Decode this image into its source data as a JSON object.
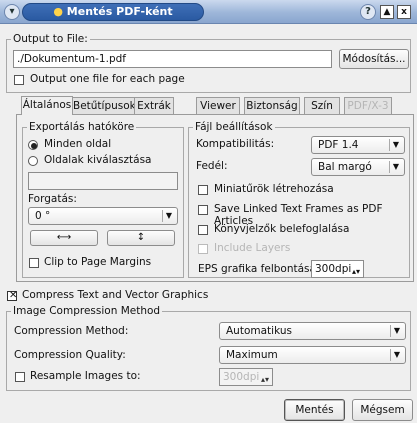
{
  "window": {
    "title": "Mentés PDF-ként",
    "help": "?",
    "minimize": "▲",
    "close": "x"
  },
  "output": {
    "legend": "Output to File:",
    "path": "./Dokumentum-1.pdf",
    "change_button": "Módosítás...",
    "one_file_label": "Output one file for each page",
    "one_file_checked": false
  },
  "tabs": [
    "Általános",
    "Betűtípusok",
    "Extrák",
    "Viewer",
    "Biztonság",
    "Szín",
    "PDF/X-3"
  ],
  "export_range": {
    "legend": "Exportálás hatóköre",
    "all_pages": "Minden oldal",
    "choose_pages": "Oldalak kiválasztása",
    "pages_value": "",
    "rotation_label": "Forgatás:",
    "rotation_value": "0 °",
    "clip_label": "Clip to Page Margins"
  },
  "file_settings": {
    "legend": "Fájl beállítások",
    "compat_label": "Kompatibilitás:",
    "compat_value": "PDF 1.4",
    "binding_label": "Fedél:",
    "binding_value": "Bal margó",
    "thumbnails": "Miniatűrök létrehozása",
    "linked_frames": "Save Linked Text Frames as PDF Articles",
    "bookmarks": "Könyvjelzők belefoglalása",
    "include_layers": "Include Layers",
    "eps_label": "EPS grafika felbontása:",
    "eps_value": "300dpi"
  },
  "compress": {
    "label": "Compress Text and Vector Graphics",
    "checked": true
  },
  "image_compression": {
    "legend": "Image Compression Method",
    "method_label": "Compression Method:",
    "method_value": "Automatikus",
    "quality_label": "Compression Quality:",
    "quality_value": "Maximum",
    "resample_label": "Resample Images to:",
    "resample_value": "300dpi"
  },
  "buttons": {
    "save": "Mentés",
    "cancel": "Mégsem"
  }
}
